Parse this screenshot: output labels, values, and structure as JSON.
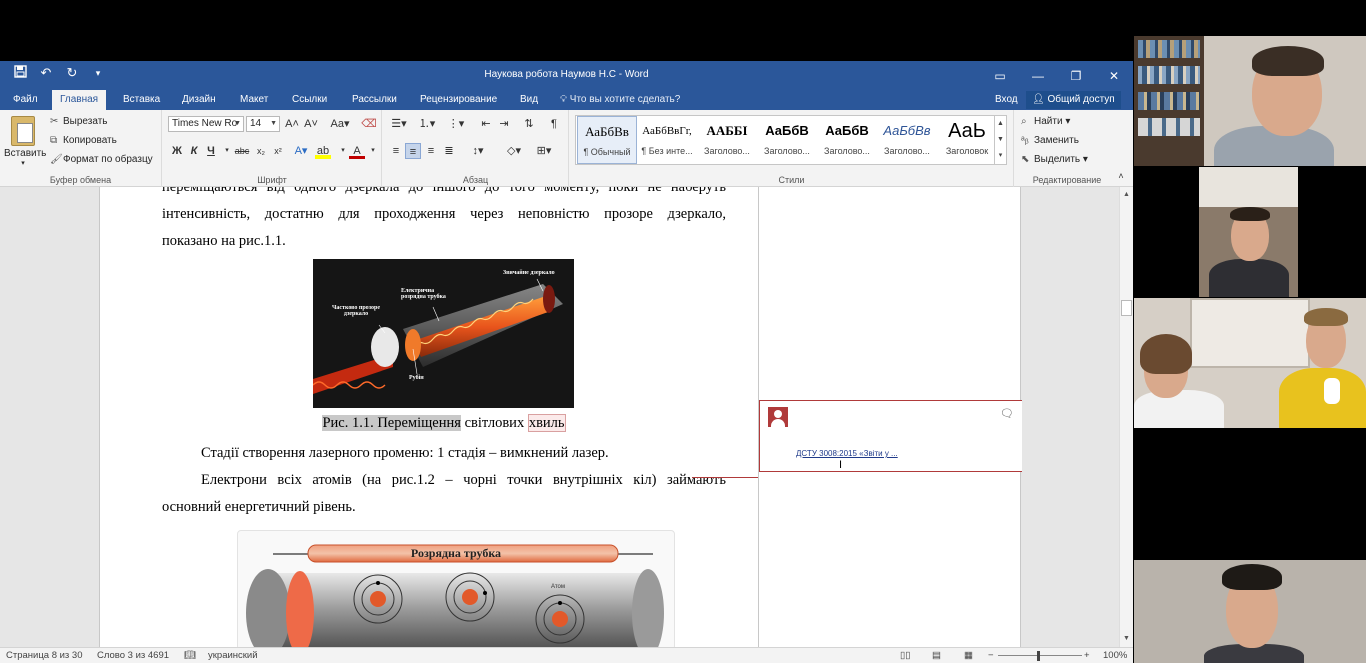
{
  "window": {
    "title": "Наукова робота Наумов Н.С - Word",
    "qat": {
      "save_icon": "save-icon",
      "undo_icon": "undo-icon",
      "redo_icon": "redo-icon",
      "customize_icon": "chevron-down-icon"
    }
  },
  "tabs": [
    {
      "label": "Файл"
    },
    {
      "label": "Главная"
    },
    {
      "label": "Вставка"
    },
    {
      "label": "Дизайн"
    },
    {
      "label": "Макет"
    },
    {
      "label": "Ссылки"
    },
    {
      "label": "Рассылки"
    },
    {
      "label": "Рецензирование"
    },
    {
      "label": "Вид"
    }
  ],
  "active_tab": "Главная",
  "tell_me": "Что вы хотите сделать?",
  "sign_in": "Вход",
  "share": "Общий доступ",
  "ribbon": {
    "clipboard": {
      "name": "Буфер обмена",
      "paste": "Вставить",
      "cut": "Вырезать",
      "copy": "Копировать",
      "format_painter": "Формат по образцу"
    },
    "font": {
      "name": "Шрифт",
      "font_family": "Times New Ro",
      "font_size": "14"
    },
    "paragraph": {
      "name": "Абзац"
    },
    "styles": {
      "name": "Стили",
      "items": [
        {
          "sample": "АаБбВв",
          "label": "¶ Обычный"
        },
        {
          "sample": "АаБбВвГг,",
          "label": "¶ Без инте..."
        },
        {
          "sample": "ААББІ",
          "label": "Заголово..."
        },
        {
          "sample": "АаБбВ",
          "label": "Заголово..."
        },
        {
          "sample": "АаБбВ",
          "label": "Заголово..."
        },
        {
          "sample": "АаБбВв",
          "label": "Заголово..."
        },
        {
          "sample": "АаЬ",
          "label": "Заголовок"
        }
      ]
    },
    "editing": {
      "name": "Редактирование",
      "find": "Найти",
      "replace": "Заменить",
      "select": "Выделить"
    }
  },
  "document": {
    "lines": [
      "переміщаються від одного дзеркала до іншого до того моменту, поки не наберуть",
      "інтенсивність, достатню для проходження через неповністю прозоре дзеркало,",
      "показано на рис.1.1."
    ],
    "figure1": {
      "labels": {
        "mirror_partial": "Частково прозоре дзеркало",
        "tube": "Електрична розрядна трубка",
        "mirror_full": "Звичайне дзеркало",
        "ruby": "Рубін"
      }
    },
    "caption": {
      "selected_part": "Рис. 1.1. Переміщення",
      "middle": " світлових ",
      "comment_part": "хвиль"
    },
    "para2": "Стадії створення лазерного променю:  1 стадія – вимкнений лазер.",
    "para3_line1": "Електрони всіх атомів (на рис.1.2 – чорні точки внутрішніх кіл) займають",
    "para3_line2": "основний енергетичний рівень.",
    "figure2": {
      "title": "Розрядна трубка",
      "atom_label": "Атом"
    }
  },
  "comment": {
    "text": "ДСТУ 3008:2015 «Звіти у ..."
  },
  "status": {
    "page": "Страница 8 из 30",
    "words": "Слово 3 из 4691",
    "language": "украинский",
    "zoom": "100%"
  },
  "colors": {
    "word_blue": "#2b579a",
    "comment_red": "#b03a3a"
  }
}
